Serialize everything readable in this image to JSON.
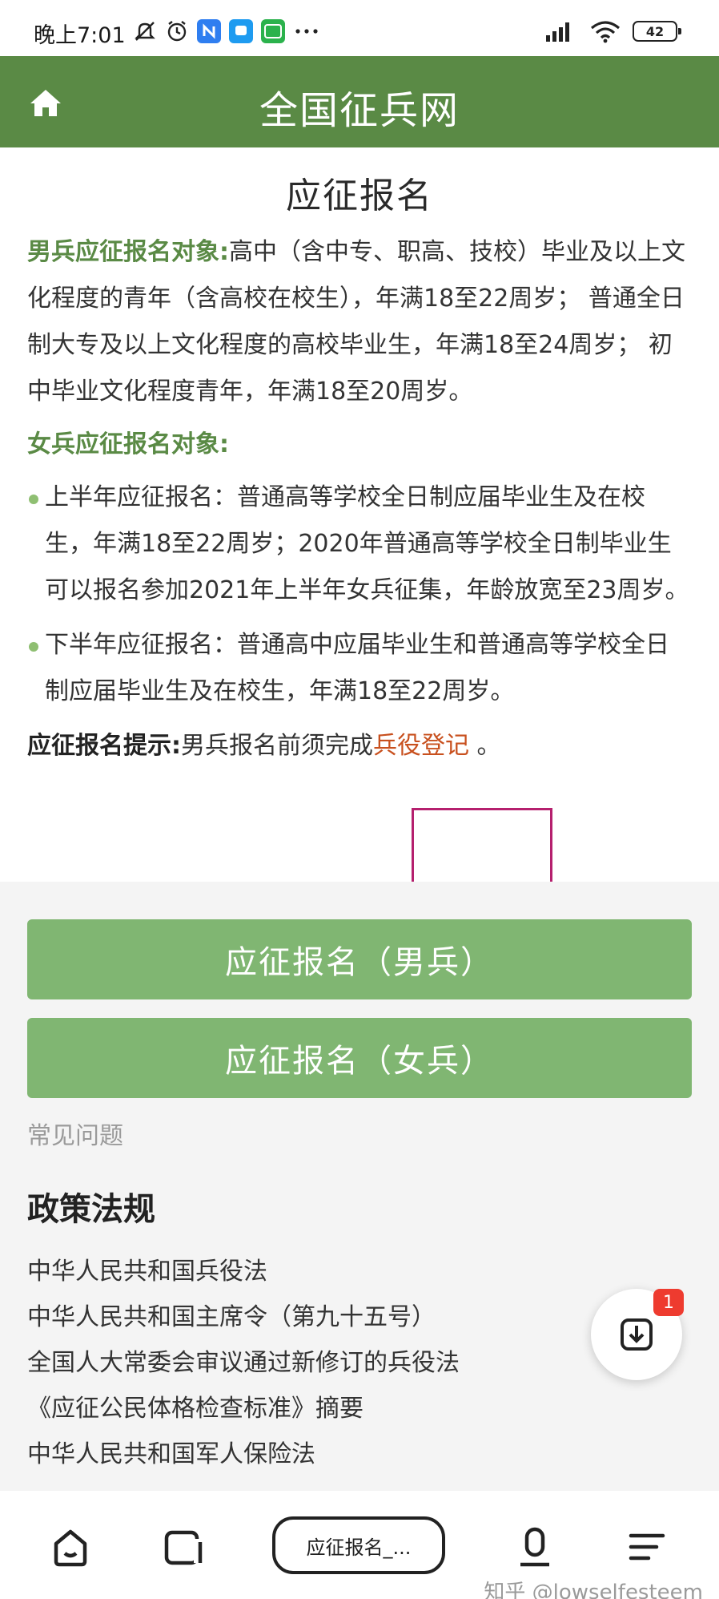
{
  "status_bar": {
    "time": "晚上7:01",
    "battery": "42"
  },
  "header": {
    "title": "全国征兵网"
  },
  "main": {
    "title": "应征报名",
    "male": {
      "label": "男兵应征报名对象:",
      "text": "高中（含中专、职高、技校）毕业及以上文化程度的青年（含高校在校生），年满18至22周岁； 普通全日制大专及以上文化程度的高校毕业生，年满18至24周岁； 初中毕业文化程度青年，年满18至20周岁。"
    },
    "female": {
      "label": "女兵应征报名对象:",
      "items": [
        "上半年应征报名：普通高等学校全日制应届毕业生及在校生，年满18至22周岁；2020年普通高等学校全日制毕业生可以报名参加2021年上半年女兵征集，年龄放宽至23周岁。",
        "下半年应征报名：普通高中应届毕业生和普通高等学校全日制应届毕业生及在校生，年满18至22周岁。"
      ]
    },
    "tip": {
      "label": "应征报名提示:",
      "text": "男兵报名前须完成",
      "link": "兵役登记",
      "end": " 。"
    }
  },
  "buttons": {
    "male": "应征报名（男兵）",
    "female": "应征报名（女兵）"
  },
  "faq": "常见问题",
  "policy": {
    "heading": "政策法规",
    "items": [
      "中华人民共和国兵役法",
      "中华人民共和国主席令（第九十五号）",
      "全国人大常委会审议通过新修订的兵役法",
      "《应征公民体格检查标准》摘要",
      "中华人民共和国军人保险法"
    ]
  },
  "fab": {
    "badge": "1"
  },
  "bottom_bar": {
    "tab_label": "应征报名_..."
  },
  "watermark": "知乎 @lowselfesteem",
  "colors": {
    "header": "#5a8a45",
    "button": "#80b672",
    "link": "#c8501e",
    "highlight": "#b5206e"
  }
}
